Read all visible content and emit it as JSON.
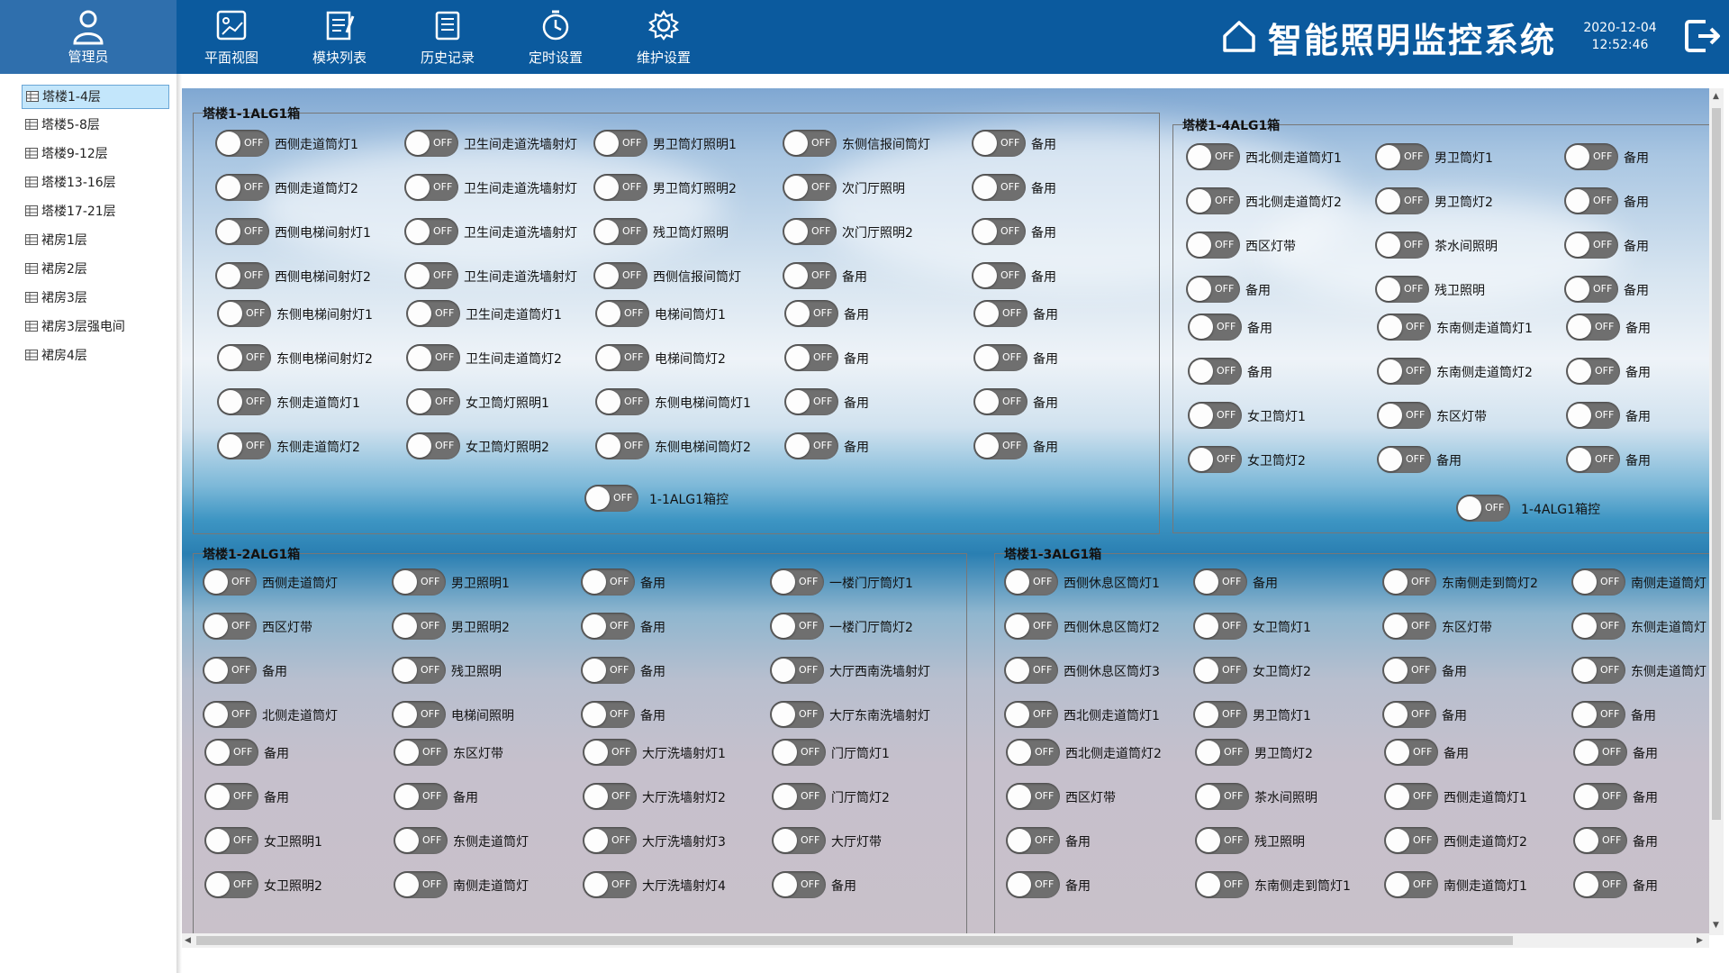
{
  "header": {
    "admin_label": "管理员",
    "nav": [
      {
        "label": "平面视图",
        "icon": "floor-plan-icon"
      },
      {
        "label": "模块列表",
        "icon": "module-list-icon"
      },
      {
        "label": "历史记录",
        "icon": "history-icon"
      },
      {
        "label": "定时设置",
        "icon": "timer-icon"
      },
      {
        "label": "维护设置",
        "icon": "gear-icon"
      }
    ],
    "title": "智能照明监控系统",
    "date": "2020-12-04",
    "time": "12:52:46"
  },
  "sidebar": {
    "selected": 0,
    "items": [
      "塔楼1-4层",
      "塔楼5-8层",
      "塔楼9-12层",
      "塔楼13-16层",
      "塔楼17-21层",
      "裙房1层",
      "裙房2层",
      "裙房3层",
      "裙房3层强电间",
      "裙房4层"
    ]
  },
  "switch_state_text": "OFF",
  "groups": {
    "g11": {
      "title": "塔楼1-1ALG1箱",
      "columns": [
        [
          "西侧走道筒灯1",
          "西侧走道筒灯2",
          "西侧电梯间射灯1",
          "西侧电梯间射灯2",
          "东侧电梯间射灯1",
          "东侧电梯间射灯2",
          "东侧走道筒灯1",
          "东侧走道筒灯2"
        ],
        [
          "卫生间走道洗墙射灯",
          "卫生间走道洗墙射灯",
          "卫生间走道洗墙射灯",
          "卫生间走道洗墙射灯",
          "卫生间走道筒灯1",
          "卫生间走道筒灯2",
          "女卫筒灯照明1",
          "女卫筒灯照明2"
        ],
        [
          "男卫筒灯照明1",
          "男卫筒灯照明2",
          "残卫筒灯照明",
          "西侧信报间筒灯",
          "电梯间筒灯1",
          "电梯间筒灯2",
          "东侧电梯间筒灯1",
          "东侧电梯间筒灯2"
        ],
        [
          "东侧信报间筒灯",
          "次门厅照明",
          "次门厅照明2",
          "备用",
          "备用",
          "备用",
          "备用",
          "备用"
        ],
        [
          "备用",
          "备用",
          "备用",
          "备用",
          "备用",
          "备用",
          "备用",
          "备用"
        ]
      ],
      "master": "1-1ALG1箱控"
    },
    "g14": {
      "title": "塔楼1-4ALG1箱",
      "columns": [
        [
          "西北侧走道筒灯1",
          "西北侧走道筒灯2",
          "西区灯带",
          "备用",
          "备用",
          "备用",
          "女卫筒灯1",
          "女卫筒灯2"
        ],
        [
          "男卫筒灯1",
          "男卫筒灯2",
          "茶水间照明",
          "残卫照明",
          "东南侧走道筒灯1",
          "东南侧走道筒灯2",
          "东区灯带",
          "备用"
        ],
        [
          "备用",
          "备用",
          "备用",
          "备用",
          "备用",
          "备用",
          "备用",
          "备用"
        ]
      ],
      "master": "1-4ALG1箱控"
    },
    "g12": {
      "title": "塔楼1-2ALG1箱",
      "columns": [
        [
          "西侧走道筒灯",
          "西区灯带",
          "备用",
          "北侧走道筒灯",
          "备用",
          "备用",
          "女卫照明1",
          "女卫照明2"
        ],
        [
          "男卫照明1",
          "男卫照明2",
          "残卫照明",
          "电梯间照明",
          "东区灯带",
          "备用",
          "东侧走道筒灯",
          "南侧走道筒灯"
        ],
        [
          "备用",
          "备用",
          "备用",
          "备用",
          "大厅洗墙射灯1",
          "大厅洗墙射灯2",
          "大厅洗墙射灯3",
          "大厅洗墙射灯4"
        ],
        [
          "一楼门厅筒灯1",
          "一楼门厅筒灯2",
          "大厅西南洗墙射灯",
          "大厅东南洗墙射灯",
          "门厅筒灯1",
          "门厅筒灯2",
          "大厅灯带",
          "备用"
        ]
      ]
    },
    "g13": {
      "title": "塔楼1-3ALG1箱",
      "columns": [
        [
          "西侧休息区筒灯1",
          "西侧休息区筒灯2",
          "西侧休息区筒灯3",
          "西北侧走道筒灯1",
          "西北侧走道筒灯2",
          "西区灯带",
          "备用",
          "备用"
        ],
        [
          "备用",
          "女卫筒灯1",
          "女卫筒灯2",
          "男卫筒灯1",
          "男卫筒灯2",
          "茶水间照明",
          "残卫照明",
          "东南侧走到筒灯1"
        ],
        [
          "东南侧走到筒灯2",
          "东区灯带",
          "备用",
          "备用",
          "备用",
          "西侧走道筒灯1",
          "西侧走道筒灯2",
          "南侧走道筒灯1"
        ],
        [
          "南侧走道筒灯",
          "东侧走道筒灯",
          "东侧走道筒灯",
          "备用",
          "备用",
          "备用",
          "备用",
          "备用"
        ]
      ]
    }
  }
}
